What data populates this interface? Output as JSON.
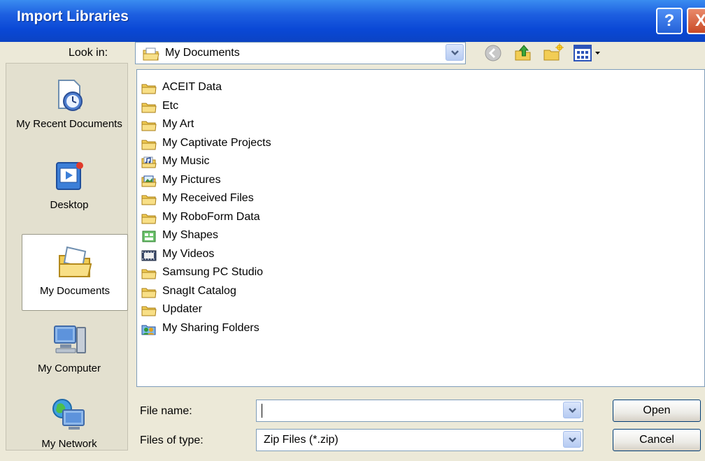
{
  "window": {
    "title": "Import Libraries",
    "help_glyph": "?",
    "close_glyph": "X"
  },
  "lookin": {
    "label": "Look in:",
    "value": "My Documents"
  },
  "places": [
    {
      "label": "My Recent Documents",
      "icon": "recent-documents-icon"
    },
    {
      "label": "Desktop",
      "icon": "desktop-icon"
    },
    {
      "label": "My Documents",
      "icon": "my-documents-icon",
      "selected": true
    },
    {
      "label": "My Computer",
      "icon": "my-computer-icon"
    },
    {
      "label": "My Network",
      "icon": "my-network-icon"
    }
  ],
  "files": [
    {
      "name": "ACEIT Data",
      "icon": "folder-icon"
    },
    {
      "name": "Etc",
      "icon": "folder-icon"
    },
    {
      "name": "My Art",
      "icon": "folder-icon"
    },
    {
      "name": "My Captivate Projects",
      "icon": "folder-icon"
    },
    {
      "name": "My Music",
      "icon": "music-folder-icon"
    },
    {
      "name": "My Pictures",
      "icon": "pictures-folder-icon"
    },
    {
      "name": "My Received Files",
      "icon": "folder-icon"
    },
    {
      "name": "My RoboForm Data",
      "icon": "folder-icon"
    },
    {
      "name": "My Shapes",
      "icon": "shapes-folder-icon"
    },
    {
      "name": "My Videos",
      "icon": "videos-folder-icon"
    },
    {
      "name": "Samsung PC Studio",
      "icon": "folder-icon"
    },
    {
      "name": "SnagIt Catalog",
      "icon": "folder-icon"
    },
    {
      "name": "Updater",
      "icon": "folder-icon"
    },
    {
      "name": "My Sharing Folders",
      "icon": "sharing-folder-icon"
    }
  ],
  "filename": {
    "label": "File name:",
    "value": ""
  },
  "filetype": {
    "label": "Files of type:",
    "value": "Zip Files (*.zip)"
  },
  "buttons": {
    "open": "Open",
    "cancel": "Cancel"
  }
}
